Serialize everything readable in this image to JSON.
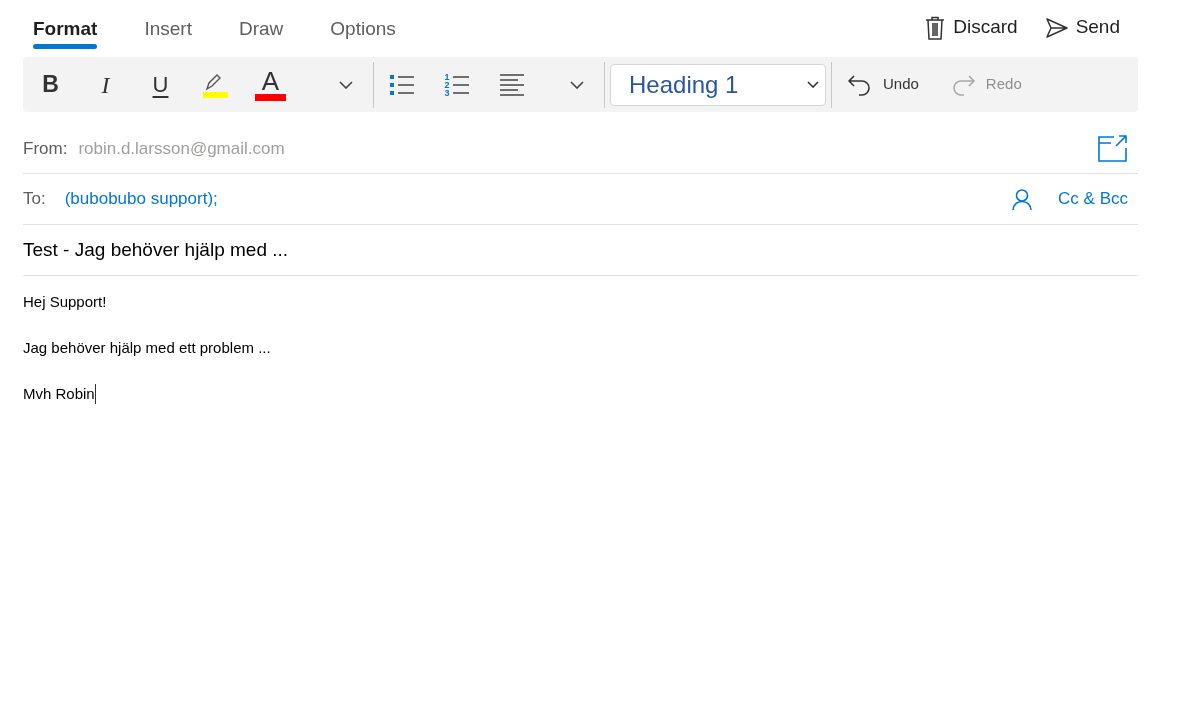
{
  "tabs": [
    {
      "label": "Format",
      "selected": true
    },
    {
      "label": "Insert",
      "selected": false
    },
    {
      "label": "Draw",
      "selected": false
    },
    {
      "label": "Options",
      "selected": false
    }
  ],
  "actions": [
    {
      "kind": "discard",
      "label": "Discard"
    },
    {
      "kind": "send",
      "label": "Send"
    }
  ],
  "toolbar": {
    "format_buttons": [
      {
        "kind": "bold",
        "label": "B"
      },
      {
        "kind": "italic",
        "label": "I"
      },
      {
        "kind": "underline",
        "label": "U"
      },
      {
        "kind": "highlight",
        "color": "#ffff00"
      },
      {
        "kind": "font-color",
        "label": "A",
        "color": "#ff0000"
      },
      {
        "kind": "more"
      }
    ],
    "paragraph_buttons": [
      {
        "kind": "bullets"
      },
      {
        "kind": "numbering",
        "label": "123"
      },
      {
        "kind": "align"
      },
      {
        "kind": "more"
      }
    ],
    "style": {
      "value": "Heading 1"
    },
    "history": [
      {
        "kind": "undo",
        "label": "Undo",
        "disabled": false
      },
      {
        "kind": "redo",
        "label": "Redo",
        "disabled": true
      }
    ]
  },
  "from": {
    "label": "From:",
    "value": "robin.d.larsson@gmail.com"
  },
  "to": {
    "label": "To:",
    "value": "(bubobubo support);",
    "cc_bcc": "Cc & Bcc"
  },
  "subject": "Test - Jag behöver hjälp med ...",
  "body": [
    "Hej Support!",
    "Jag behöver hjälp med ett problem ...",
    "Mvh Robin"
  ]
}
